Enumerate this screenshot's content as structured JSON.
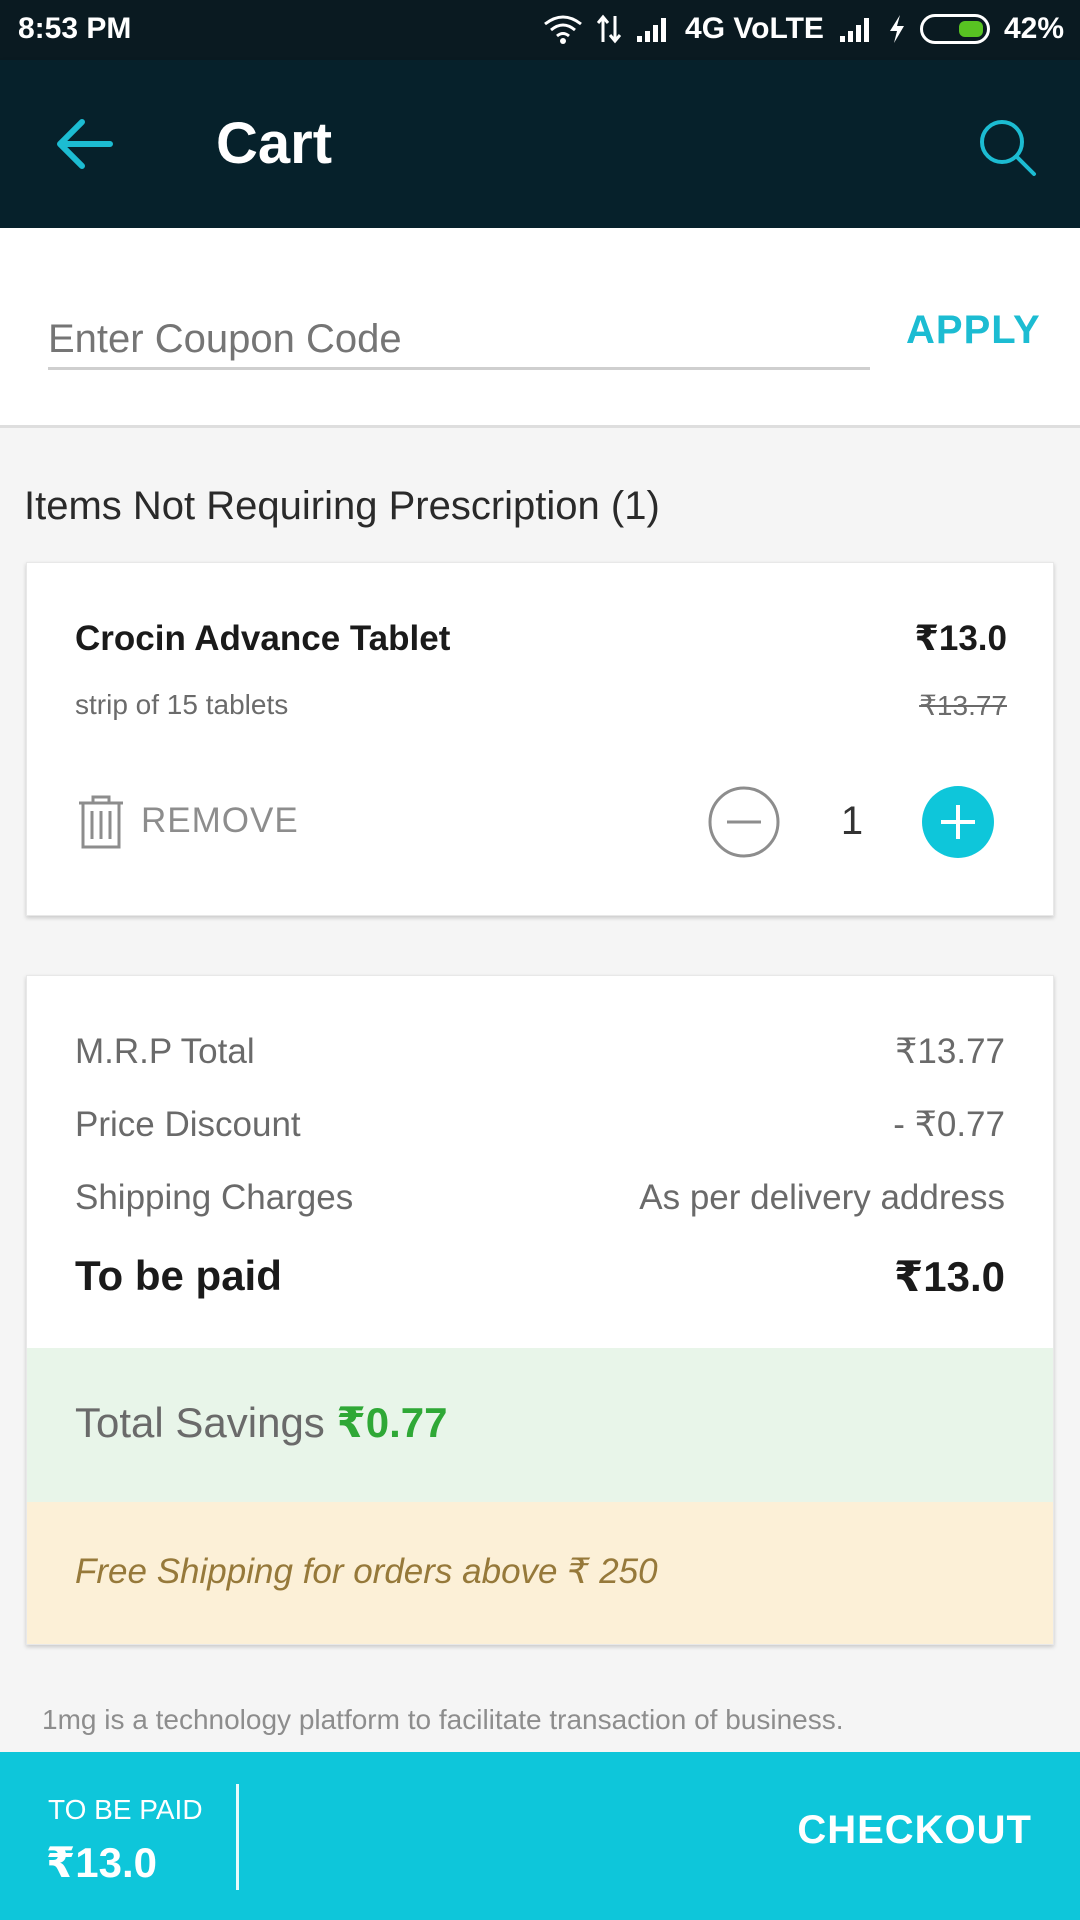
{
  "status_bar": {
    "time": "8:53 PM",
    "network": "4G VoLTE",
    "battery": "42%",
    "battery_level": 0.42,
    "icons": [
      "wifi-icon",
      "data-arrows-icon",
      "signal-icon",
      "signal-icon",
      "charging-icon",
      "battery-icon"
    ]
  },
  "app_bar": {
    "title": "Cart",
    "back_icon": "back-arrow-icon",
    "search_icon": "search-icon"
  },
  "coupon": {
    "placeholder": "Enter Coupon Code",
    "apply_label": "APPLY"
  },
  "section": {
    "title": "Items Not Requiring Prescription (1)"
  },
  "item": {
    "name": "Crocin Advance Tablet",
    "price": "₹13.0",
    "pack": "strip of 15 tablets",
    "mrp": "₹13.77",
    "remove_label": "REMOVE",
    "quantity": "1"
  },
  "summary": {
    "rows": [
      {
        "label": "M.R.P Total",
        "value": "₹13.77"
      },
      {
        "label": "Price Discount",
        "value": "- ₹0.77"
      },
      {
        "label": "Shipping Charges",
        "value": "As per delivery address"
      }
    ],
    "to_be_paid_label": "To be paid",
    "to_be_paid_value": "₹13.0",
    "savings_label": "Total Savings",
    "savings_value": "₹0.77",
    "shipping_note": "Free Shipping for orders above ₹ 250"
  },
  "disclaimer": "1mg is a technology platform to facilitate transaction of business.",
  "bottom_bar": {
    "to_be_paid_label": "TO BE PAID",
    "to_be_paid_value": "₹13.0",
    "checkout_label": "CHECKOUT"
  },
  "colors": {
    "app_bar": "#06212b",
    "accent": "#0ec6da",
    "savings_bg": "#e8f5e9",
    "savings_text": "#2fa836",
    "shipping_bg": "#fcf0d7"
  }
}
